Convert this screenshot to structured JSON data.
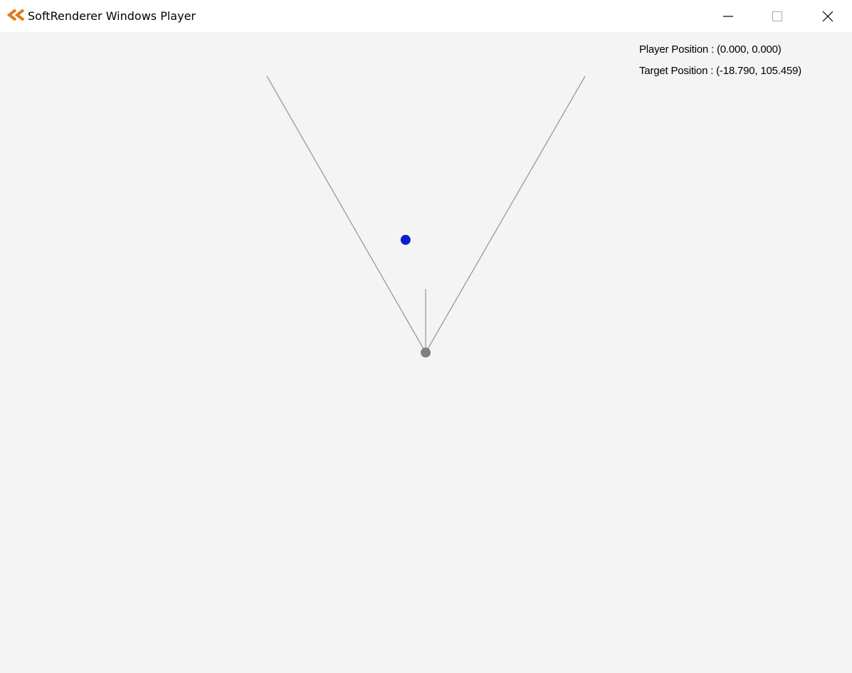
{
  "window": {
    "title": "SoftRenderer Windows Player",
    "icon": "softrenderer-app-icon",
    "accent_color": "#e07b1a",
    "controls": {
      "minimize_icon": "minimize-icon",
      "maximize_icon": "maximize-icon",
      "close_icon": "close-icon"
    }
  },
  "hud": {
    "player_position": "Player Position : (0.000, 0.000)",
    "target_position": "Target Position : (-18.790, 105.459)"
  },
  "scene": {
    "background_color": "#f4f4f4",
    "player_color": "#808080",
    "target_color": "#0a1fc8",
    "line_color": "#9a9a9a",
    "player": {
      "x": 0.0,
      "y": 0.0
    },
    "target": {
      "x": -18.79,
      "y": 105.459
    }
  }
}
